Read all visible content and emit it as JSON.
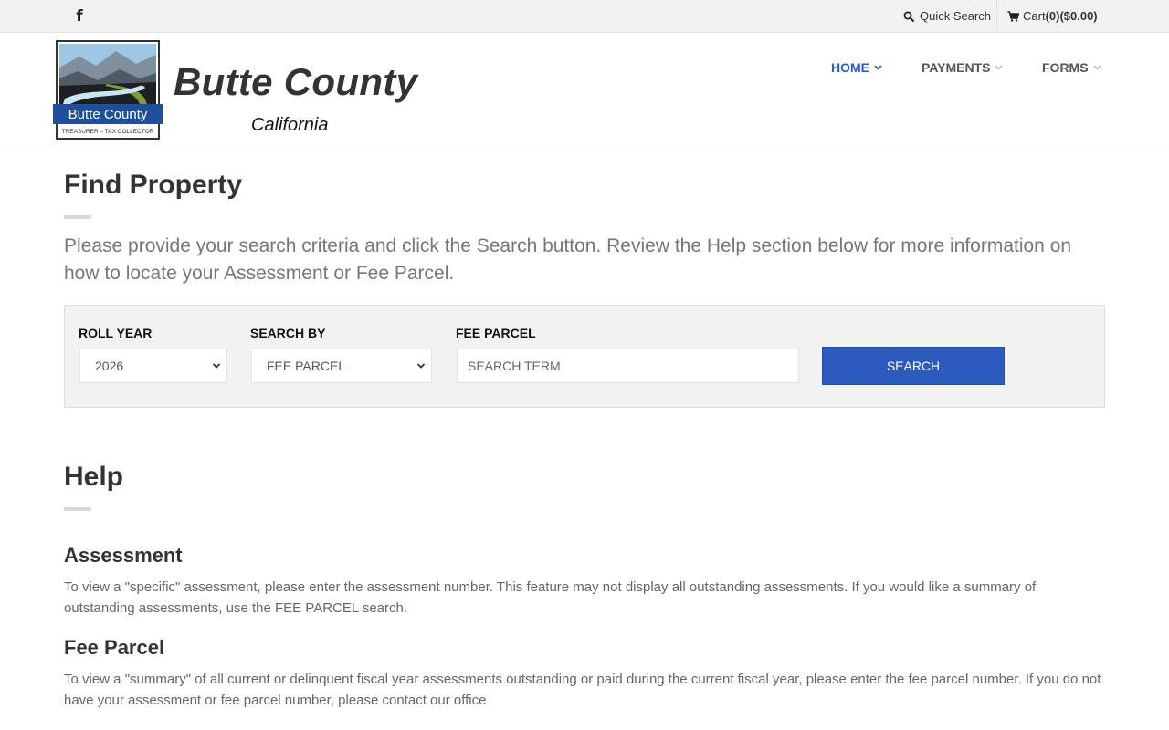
{
  "topbar": {
    "quick_search_label": "Quick Search",
    "cart_prefix": "Cart ",
    "cart_value": "(0)($0.00)"
  },
  "brand": {
    "title": "Butte County",
    "subtitle": "California",
    "logo_name": "Butte County",
    "logo_tagline": "TREASURER – TAX COLLECTOR"
  },
  "nav": {
    "items": [
      {
        "label": "HOME",
        "active": true
      },
      {
        "label": "PAYMENTS",
        "active": false
      },
      {
        "label": "FORMS",
        "active": false
      }
    ]
  },
  "main": {
    "title": "Find Property",
    "intro": "Please provide your search criteria and click the Search button. Review the Help section below for more information on how to locate your Assessment or Fee Parcel."
  },
  "search": {
    "roll_year_label": "ROLL YEAR",
    "roll_year_value": "2026",
    "search_by_label": "SEARCH BY",
    "search_by_value": "FEE PARCEL",
    "term_label": "FEE PARCEL",
    "term_placeholder": "SEARCH TERM",
    "button_label": "SEARCH"
  },
  "help": {
    "title": "Help",
    "sections": [
      {
        "heading": "Assessment",
        "text": "To view a \"specific\" assessment, please enter the assessment number. This feature may not display all outstanding assessments. If you would like a summary of outstanding assessments, use the FEE PARCEL search."
      },
      {
        "heading": "Fee Parcel",
        "text": "To view a \"summary\" of all current or delinquent fiscal year assessments outstanding or paid during the current fiscal year, please enter the fee parcel number. If you do not have your assessment or fee parcel number, please contact our office"
      }
    ]
  },
  "colors": {
    "accent": "#2c5bbd",
    "panel_bg": "#f2f2f2",
    "topbar_bg": "#f2f2f2",
    "logo_blue": "#1f4f9a"
  },
  "icons": {
    "facebook": "facebook-icon",
    "search": "search-icon",
    "cart": "cart-icon",
    "chevron": "chevron-down-icon"
  }
}
